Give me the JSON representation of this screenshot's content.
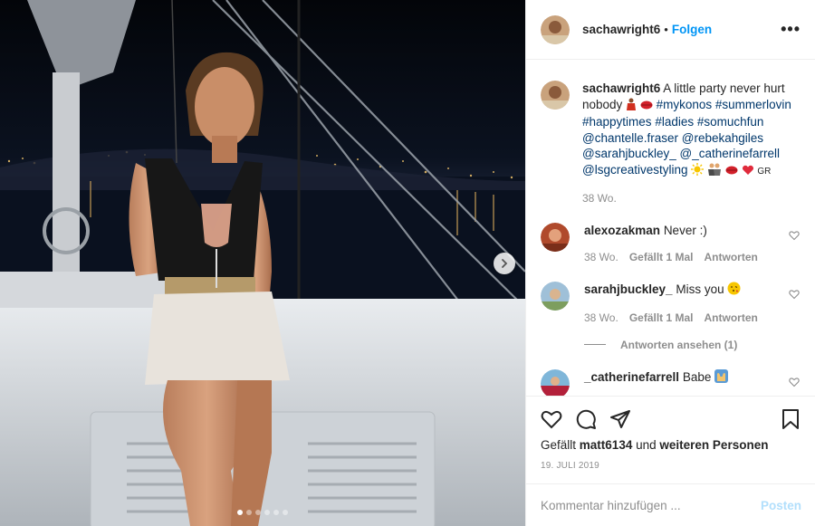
{
  "post": {
    "username": "sachawright6",
    "separator": "•",
    "follow_label": "Folgen",
    "more_label": "•••"
  },
  "caption": {
    "username": "sachawright6",
    "text": "A little party never hurt nobody",
    "hashtags": [
      "#mykonos",
      "#summerlovin",
      "#happytimes",
      "#ladies",
      "#somuchfun"
    ],
    "mentions": [
      "@chantelle.fraser",
      "@rebekahgiles",
      "@sarahjbuckley_",
      "@_catherinefarrell",
      "@lsgcreativestyling"
    ],
    "suffix": "GR",
    "time": "38 Wo."
  },
  "comments": [
    {
      "username": "alexozakman",
      "text": "Never :)",
      "time": "38 Wo.",
      "likes": "Gefällt 1 Mal",
      "reply": "Antworten"
    },
    {
      "username": "sarahjbuckley_",
      "text": "Miss you",
      "time": "38 Wo.",
      "likes": "Gefällt 1 Mal",
      "reply": "Antworten",
      "view_replies": "Antworten ansehen (1)"
    },
    {
      "username": "_catherinefarrell",
      "text": "Babe"
    }
  ],
  "likes": {
    "prefix": "Gefällt",
    "user": "matt6134",
    "middle": "und",
    "others": "weiteren Personen"
  },
  "date": "19. JULI 2019",
  "add_comment": {
    "placeholder": "Kommentar hinzufügen ...",
    "post_label": "Posten"
  },
  "carousel": {
    "total": 6,
    "active": 1
  },
  "colors": {
    "link": "#0095f6",
    "tag": "#00376b",
    "muted": "#8e8e8e",
    "post_disabled": "#b2dffc"
  },
  "icons": [
    "chevron-right-icon",
    "more-icon",
    "heart-icon",
    "comment-icon",
    "share-icon",
    "bookmark-icon"
  ]
}
